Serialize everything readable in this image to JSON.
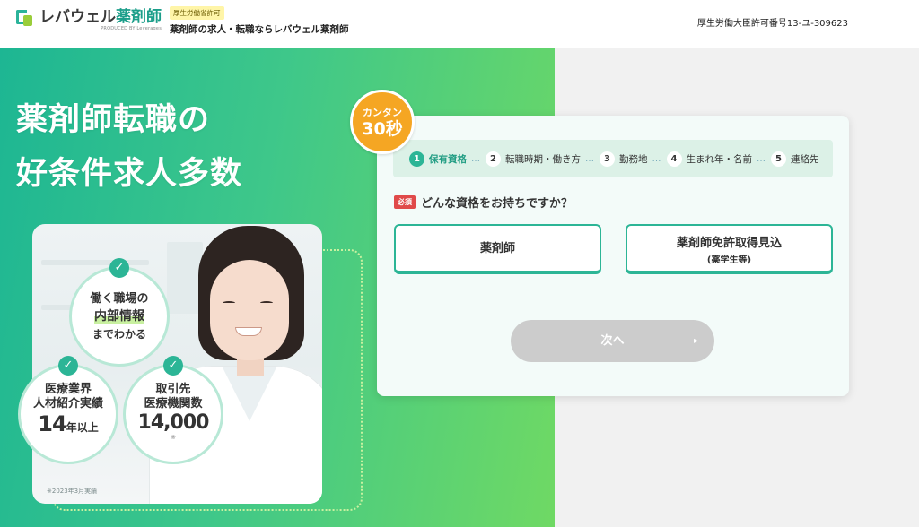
{
  "header": {
    "logo_title": "レバウェル",
    "logo_title_accent": "薬剤師",
    "logo_sub": "PRODUCED BY Leverages",
    "permit_badge": "厚生労働省許可",
    "tagline": "薬剤師の求人・転職ならレバウェル薬剤師",
    "license": "厚生労働大臣許可番号13-ユ-309623"
  },
  "hero": {
    "headline_line1": "薬剤師転職の",
    "headline_line2": "好条件求人多数",
    "footnote": "※2023年3月実績",
    "badges": {
      "info": {
        "line1": "働く職場の",
        "emph": "内部情報",
        "line3": "までわかる"
      },
      "record": {
        "line1": "医療業界",
        "line2": "人材紹介実績",
        "big": "14",
        "suffix": "年以上"
      },
      "clients": {
        "line1": "取引先",
        "line2": "医療機関数",
        "big": "14,000",
        "note": "※"
      }
    }
  },
  "form": {
    "kantan_top": "カンタン",
    "kantan_big": "30秒",
    "steps": [
      {
        "num": "1",
        "label": "保有資格"
      },
      {
        "num": "2",
        "label": "転職時期・働き方"
      },
      {
        "num": "3",
        "label": "勤務地"
      },
      {
        "num": "4",
        "label": "生まれ年・名前"
      },
      {
        "num": "5",
        "label": "連絡先"
      }
    ],
    "step_sep": "…",
    "required_label": "必須",
    "question": "どんな資格をお持ちですか？",
    "options": [
      {
        "main": "薬剤師",
        "sub": ""
      },
      {
        "main": "薬剤師免許取得見込",
        "sub": "(薬学生等)"
      }
    ],
    "next_label": "次へ",
    "next_arrow": "▸"
  }
}
